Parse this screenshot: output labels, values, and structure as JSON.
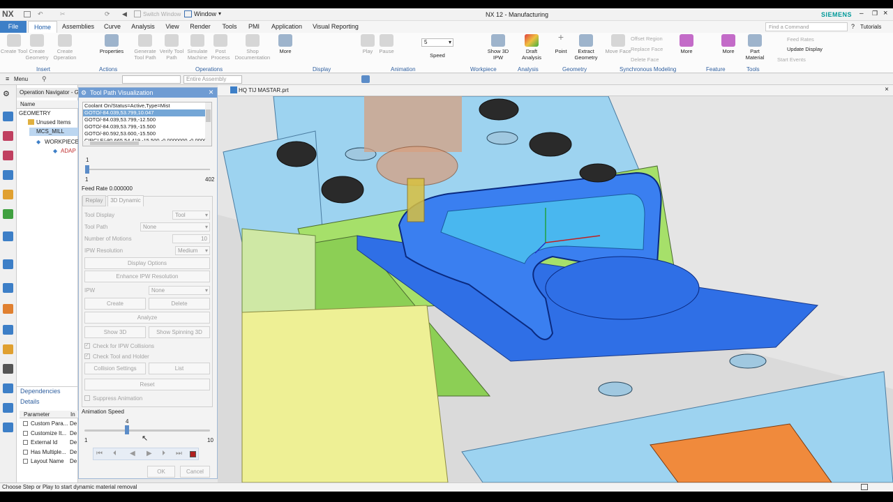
{
  "app": {
    "logo": "NX",
    "title": "NX 12 - Manufacturing",
    "brand": "SIEMENS",
    "switch_window": "Switch Window",
    "window_menu": "Window",
    "find_placeholder": "Find a Command",
    "tutorials": "Tutorials"
  },
  "tabs": [
    "File",
    "Home",
    "Assemblies",
    "Curve",
    "Analysis",
    "View",
    "Render",
    "Tools",
    "PMI",
    "Application",
    "Visual Reporting"
  ],
  "ribbon": {
    "buttons": [
      {
        "label": "Create Tool",
        "enabled": false
      },
      {
        "label": "Create Geometry",
        "enabled": false
      },
      {
        "label": "Create Operation",
        "enabled": false
      },
      {
        "label": "Properties",
        "enabled": true
      },
      {
        "label": "Generate Tool Path",
        "enabled": false
      },
      {
        "label": "Verify Tool Path",
        "enabled": false
      },
      {
        "label": "Simulate Machine",
        "enabled": false
      },
      {
        "label": "Post Process",
        "enabled": false
      },
      {
        "label": "Shop Documentation",
        "enabled": false
      },
      {
        "label": "More",
        "enabled": true
      },
      {
        "label": "Play",
        "enabled": false
      },
      {
        "label": "Pause",
        "enabled": false
      },
      {
        "label": "Speed",
        "enabled": true
      },
      {
        "label": "Show 3D IPW",
        "enabled": true
      },
      {
        "label": "Draft Analysis",
        "enabled": true
      },
      {
        "label": "Point",
        "enabled": true
      },
      {
        "label": "Extract Geometry",
        "enabled": true
      },
      {
        "label": "Move Face",
        "enabled": false
      },
      {
        "label": "More",
        "enabled": true
      },
      {
        "label": "More",
        "enabled": true
      },
      {
        "label": "Part Material",
        "enabled": true
      }
    ],
    "speed_value": "5",
    "sync_items": [
      "Offset Region",
      "Replace Face",
      "Delete Face"
    ],
    "right_items": [
      "Feed Rates",
      "Update Display",
      "Start Events"
    ],
    "groups": [
      "Insert",
      "Actions",
      "Operations",
      "Display",
      "Animation",
      "Workpiece",
      "Analysis",
      "Geometry",
      "Synchronous Modeling",
      "Feature",
      "Tools"
    ]
  },
  "toolbar2": {
    "menu": "Menu",
    "filter": "",
    "assembly": "Entire Assembly"
  },
  "file_tab": {
    "name": "HQ TIJ MASTAR.prt"
  },
  "navigator": {
    "title": "Operation Navigator - G",
    "column": "Name",
    "items": [
      "GEOMETRY",
      "Unused Items",
      "MCS_MILL",
      "WORKPIECE",
      "ADAP"
    ],
    "dependencies": "Dependencies",
    "details": "Details",
    "param_headers": [
      "Parameter",
      "In"
    ],
    "params": [
      {
        "name": "Custom Para...",
        "val": "De"
      },
      {
        "name": "Customize It...",
        "val": "De"
      },
      {
        "name": "External Id",
        "val": "De"
      },
      {
        "name": "Has Multiple...",
        "val": "De"
      },
      {
        "name": "Layout Name",
        "val": "De"
      }
    ]
  },
  "dialog": {
    "title": "Tool Path Visualization",
    "list": [
      "Coolant On/Status=Active,Type=Mist",
      "GOTO/-84.039,53.799,10.047",
      "GOTO/-84.039,53.799,-12.500",
      "GOTO/-84.039,53.799,-15.500",
      "GOTO/-80.592,53.600,-15.500",
      "CIRCLE/-80.665,54.419,-15.500,-0.0000000,-0.00000"
    ],
    "selected_index": 1,
    "slider": {
      "top": "1",
      "min": "1",
      "max": "402",
      "value": 1
    },
    "feed_rate": "Feed Rate 0.000000",
    "tabs": [
      "Replay",
      "3D Dynamic"
    ],
    "tool_display_label": "Tool Display",
    "tool_display_value": "Tool",
    "tool_path_label": "Tool Path",
    "tool_path_value": "None",
    "motions_label": "Number of Motions",
    "motions_value": "10",
    "ipw_res_label": "IPW Resolution",
    "ipw_res_value": "Medium",
    "display_options": "Display Options",
    "enhance": "Enhance IPW Resolution",
    "ipw_label": "IPW",
    "ipw_value": "None",
    "create": "Create",
    "delete": "Delete",
    "analyze": "Analyze",
    "show3d": "Show 3D",
    "spinning": "Show Spinning 3D",
    "check_collisions": "Check for IPW Collisions",
    "check_holder": "Check Tool and Holder",
    "collision_settings": "Collision Settings",
    "list_btn": "List",
    "reset": "Reset",
    "suppress": "Suppress Animation",
    "anim_speed_label": "Animation Speed",
    "anim": {
      "value": "4",
      "min": "1",
      "max": "10",
      "fraction": 0.333
    },
    "ok": "OK",
    "cancel": "Cancel"
  },
  "status": "Choose Step or Play to start dynamic material removal",
  "colors": {
    "accent": "#5b8cc8",
    "part_blue": "#2f6fe6",
    "vise_green": "#a6e06a",
    "vise_blue": "#bfe3f7",
    "orange": "#f08a3c"
  }
}
